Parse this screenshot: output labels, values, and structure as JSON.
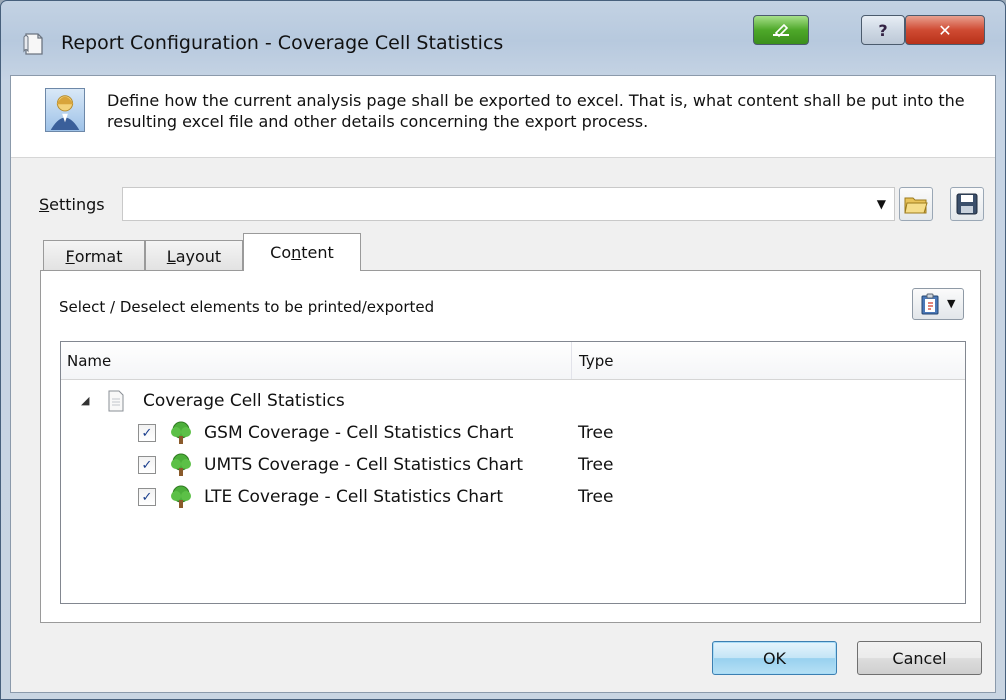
{
  "window": {
    "title": "Report Configuration - Coverage Cell Statistics"
  },
  "header": {
    "description": "Define how the current analysis page shall be exported to excel. That is, what content shall be put into the resulting excel file and other details concerning the export process."
  },
  "settings": {
    "label_prefix": "",
    "label_mnemonic": "S",
    "label_rest": "ettings",
    "value": ""
  },
  "tabs": [
    {
      "mnemonic": "F",
      "rest": "ormat",
      "active": false
    },
    {
      "mnemonic": "L",
      "rest": "ayout",
      "active": false
    },
    {
      "prefix": "Co",
      "mnemonic": "n",
      "rest": "tent",
      "active": true
    }
  ],
  "content": {
    "caption": "Select / Deselect elements to be printed/exported",
    "columns": {
      "name": "Name",
      "type": "Type"
    },
    "root": {
      "label": "Coverage Cell Statistics",
      "expanded": true
    },
    "items": [
      {
        "label": "GSM Coverage - Cell Statistics Chart",
        "type": "Tree",
        "checked": true
      },
      {
        "label": "UMTS Coverage - Cell Statistics Chart",
        "type": "Tree",
        "checked": true
      },
      {
        "label": "LTE Coverage - Cell Statistics Chart",
        "type": "Tree",
        "checked": true
      }
    ]
  },
  "buttons": {
    "ok": "OK",
    "cancel": "Cancel"
  },
  "icons": {
    "title": "report-page-icon",
    "header": "user-icon",
    "open": "folder-open-icon",
    "save": "floppy-disk-icon",
    "clipboard": "clipboard-icon",
    "tree": "tree-icon",
    "document": "document-icon"
  }
}
